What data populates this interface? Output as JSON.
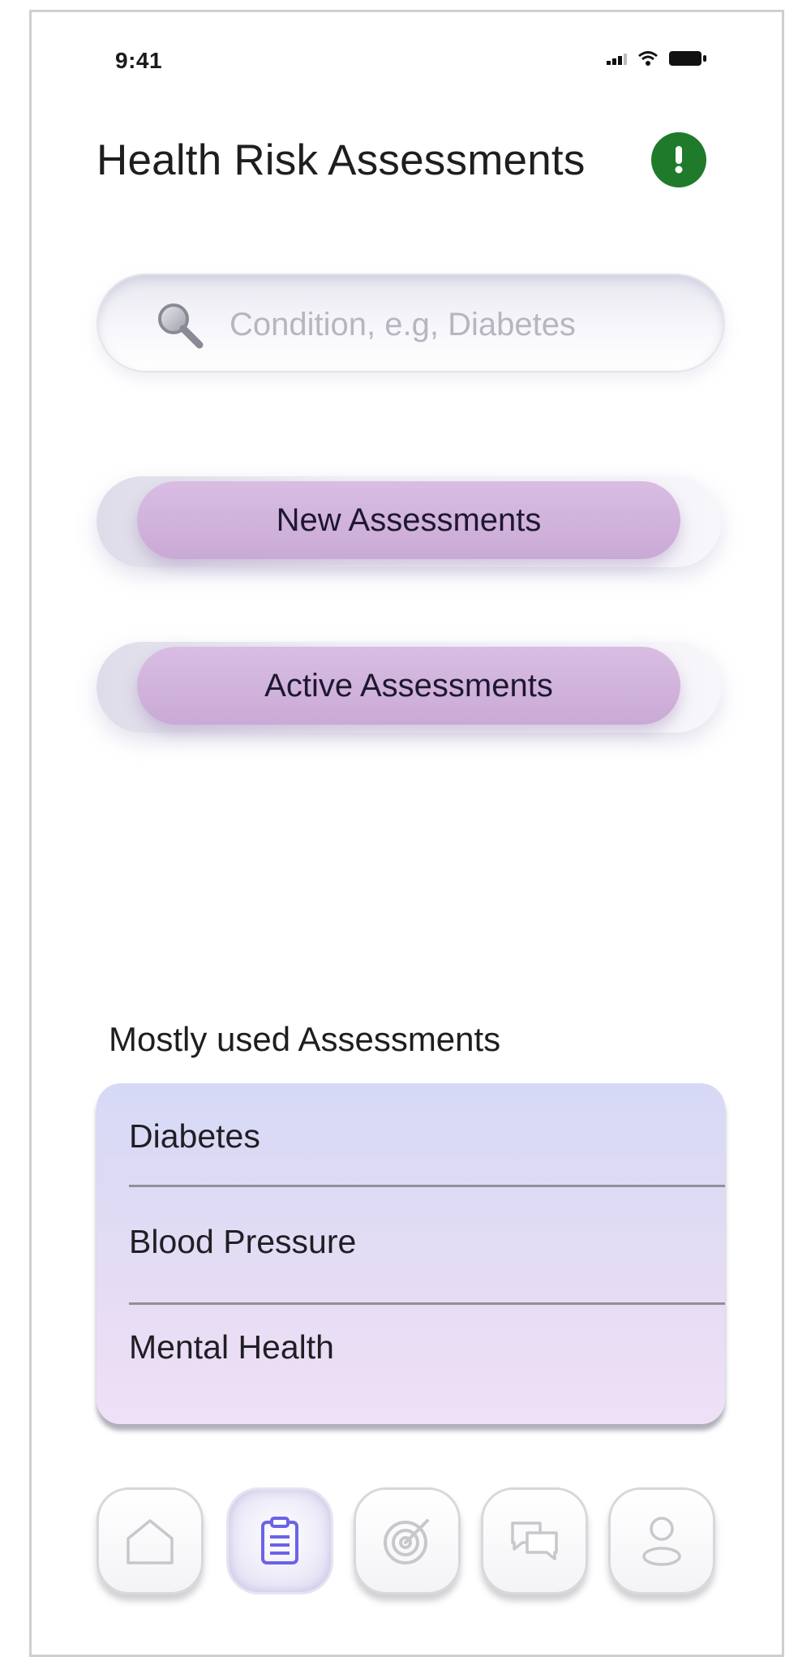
{
  "status_bar": {
    "time": "9:41"
  },
  "header": {
    "title": "Health Risk Assessments",
    "alert_icon": "exclamation-icon",
    "alert_color": "#1f7a2c"
  },
  "search": {
    "placeholder": "Condition, e.g, Diabetes",
    "value": ""
  },
  "actions": {
    "new_label": "New Assessments",
    "active_label": "Active Assessments"
  },
  "mostly_used": {
    "title": "Mostly used Assessments",
    "items": [
      "Diabetes",
      "Blood Pressure",
      "Mental Health"
    ]
  },
  "bottom_nav": {
    "items": [
      {
        "icon": "home-icon",
        "active": false
      },
      {
        "icon": "clipboard-icon",
        "active": true
      },
      {
        "icon": "target-icon",
        "active": false
      },
      {
        "icon": "chat-icon",
        "active": false
      },
      {
        "icon": "profile-icon",
        "active": false
      }
    ]
  },
  "colors": {
    "button_purple": "#d0b2dd",
    "active_nav_icon": "#6b63e8",
    "inactive_nav_icon": "#c7c7cc",
    "list_gradient_top": "#d6d9f6",
    "list_gradient_bottom": "#efe0f6"
  }
}
